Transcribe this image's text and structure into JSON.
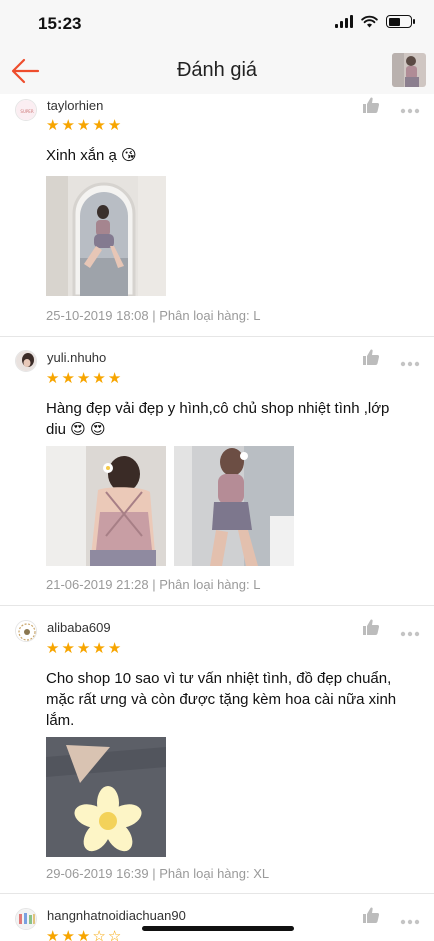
{
  "status_bar": {
    "time": "15:23",
    "battery_level": 0.55
  },
  "header": {
    "title": "Đánh giá",
    "back_icon": "arrow-left-icon",
    "accent": "#ee4d2d"
  },
  "reviews": [
    {
      "username": "taylorhien",
      "rating": 5,
      "text": "Xinh xắn ạ 😘",
      "photos": 1,
      "date": "25-10-2019 18:08 | Phân loại hàng: L"
    },
    {
      "username": "yuli.nhuho",
      "rating": 5,
      "text": "Hàng đẹp vải đẹp y hình,cô chủ shop nhiệt tình ,lớp diu 😍 😍",
      "photos": 2,
      "date": "21-06-2019 21:28 | Phân loại hàng: L"
    },
    {
      "username": "alibaba609",
      "rating": 5,
      "text": "Cho shop 10 sao vì tư vấn nhiệt tình, đồ đẹp chuẩn, mặc rất ưng và còn được tặng kèm hoa cài nữa xinh lắm.",
      "photos": 1,
      "date": "29-06-2019 16:39 | Phân loại hàng: XL"
    },
    {
      "username": "hangnhatnoidiachuan90",
      "rating": 3,
      "text": "",
      "photos": 0,
      "date": ""
    }
  ],
  "colors": {
    "star": "#f7a500",
    "meta_text": "#9a9a9a",
    "divider": "#e6e6e6"
  }
}
